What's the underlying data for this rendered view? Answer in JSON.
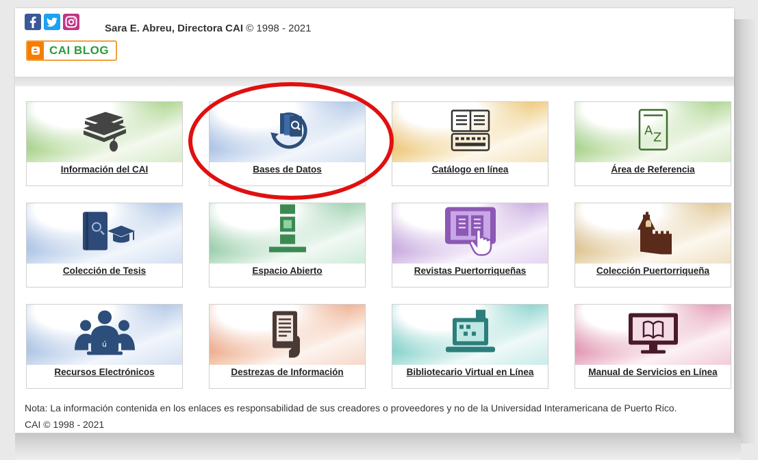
{
  "header": {
    "credit_name": "Sara E. Abreu, Directora CAI",
    "credit_copy": "© 1998 - 2021",
    "blog_label": "CAI BLOG"
  },
  "social": [
    "facebook-icon",
    "twitter-icon",
    "instagram-icon"
  ],
  "tiles": [
    {
      "label": "Información del CAI",
      "icon": "books-mouse-icon",
      "color": "#6aa84f"
    },
    {
      "label": "Bases de Datos",
      "icon": "database-search-icon",
      "color": "#4a78b8"
    },
    {
      "label": "Catálogo en línea",
      "icon": "catalog-keyboard-icon",
      "color": "#d49a2a"
    },
    {
      "label": "Área de Referencia",
      "icon": "dictionary-az-icon",
      "color": "#6aa84f"
    },
    {
      "label": "Colección de Tesis",
      "icon": "thesis-graduation-icon",
      "color": "#4a78b8"
    },
    {
      "label": "Espacio Abierto",
      "icon": "open-space-icon",
      "color": "#3c9a5f"
    },
    {
      "label": "Revistas Puertorriqueñas",
      "icon": "tablet-magazine-icon",
      "color": "#8e5bb8"
    },
    {
      "label": "Colección Puertorriqueña",
      "icon": "fort-icon",
      "color": "#b88a3c"
    },
    {
      "label": "Recursos Electrónicos",
      "icon": "users-laptop-icon",
      "color": "#4a78b8"
    },
    {
      "label": "Destrezas de Información",
      "icon": "document-hand-icon",
      "color": "#d9663a"
    },
    {
      "label": "Bibliotecario Virtual en Línea",
      "icon": "laptop-chat-icon",
      "color": "#1aa39a"
    },
    {
      "label": "Manual de Servicios en Línea",
      "icon": "monitor-book-icon",
      "color": "#c23a6a"
    }
  ],
  "footer": {
    "note": "Nota: La información contenida en los enlaces es responsabilidad de sus creadores o proveedores y no de la Universidad Interamericana de Puerto Rico.",
    "copyright": "CAI © 1998 - 2021"
  }
}
